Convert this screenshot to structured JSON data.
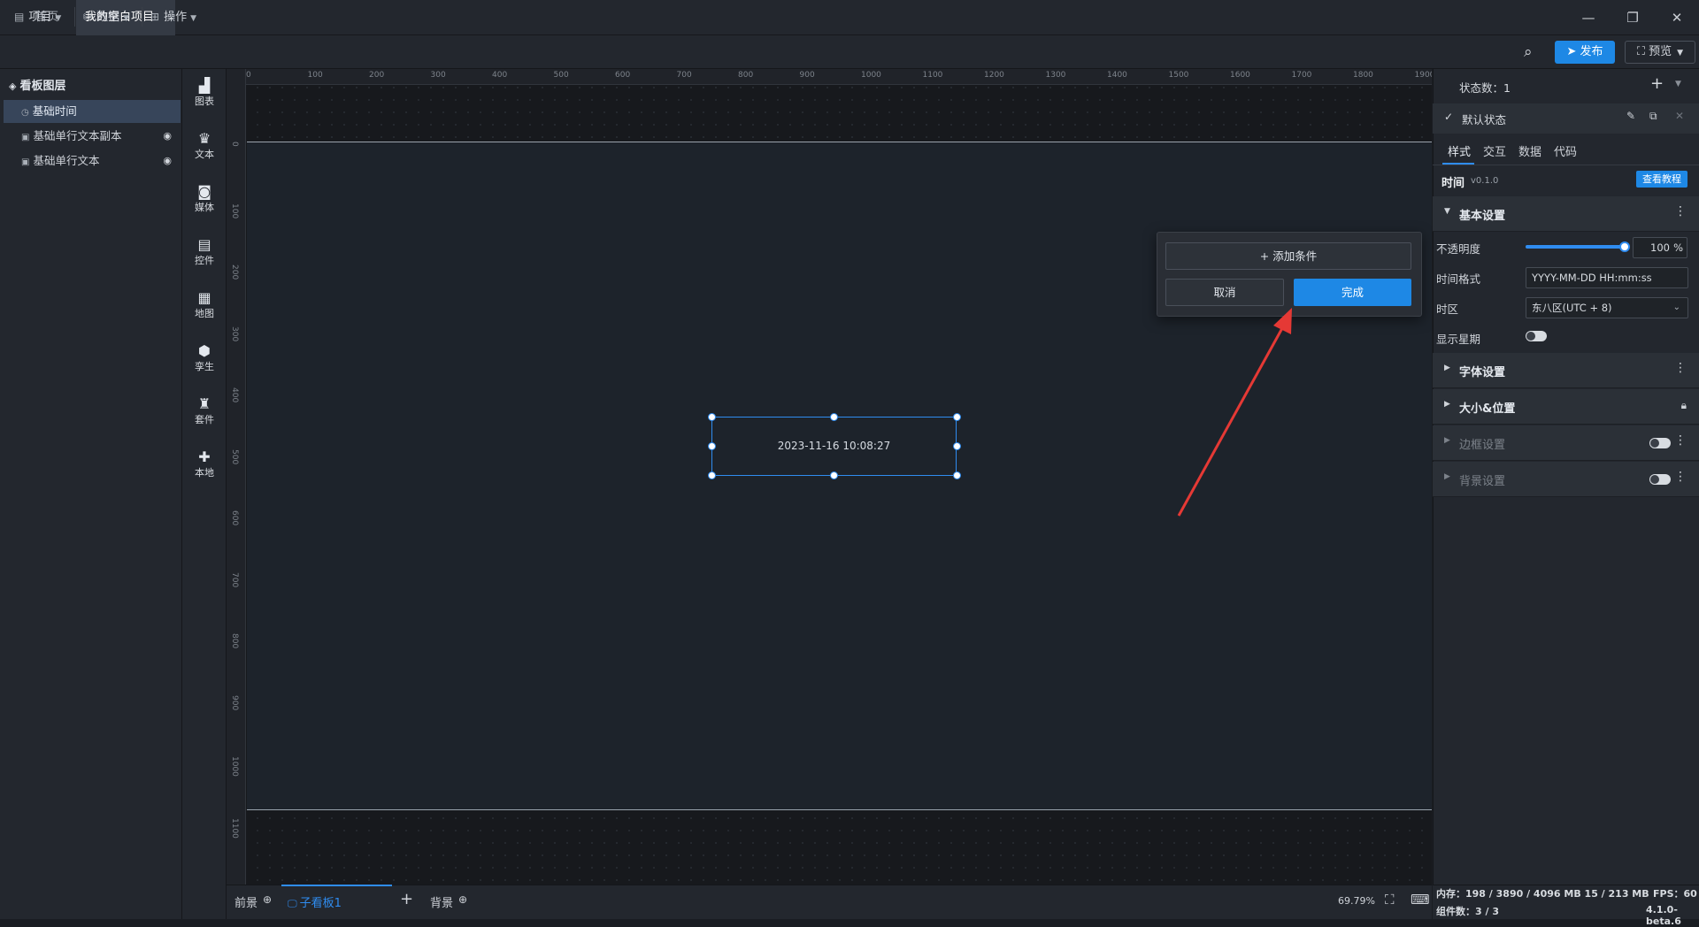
{
  "titlebar": {
    "tabs": [
      {
        "label": "首页"
      },
      {
        "label": "我的空白项目"
      }
    ]
  },
  "menubar": {
    "project": "项目",
    "data": "数据",
    "operate": "操作",
    "publish": "发布",
    "preview": "预览"
  },
  "layers": {
    "title": "看板图层",
    "items": [
      {
        "label": "基础时间"
      },
      {
        "label": "基础单行文本副本"
      },
      {
        "label": "基础单行文本"
      }
    ]
  },
  "components": [
    {
      "label": "图表",
      "icon": "bar-chart-icon"
    },
    {
      "label": "文本",
      "icon": "text-icon"
    },
    {
      "label": "媒体",
      "icon": "media-icon"
    },
    {
      "label": "控件",
      "icon": "control-icon"
    },
    {
      "label": "地图",
      "icon": "map-icon"
    },
    {
      "label": "孪生",
      "icon": "twin-cube-icon"
    },
    {
      "label": "套件",
      "icon": "kit-shirt-icon"
    },
    {
      "label": "本地",
      "icon": "puzzle-icon"
    }
  ],
  "ruler": {
    "top": [
      "0",
      "100",
      "200",
      "300",
      "400",
      "500",
      "600",
      "700",
      "800",
      "900",
      "1000",
      "1100",
      "1200",
      "1300",
      "1400",
      "1500",
      "1600",
      "1700",
      "1800",
      "1900"
    ],
    "left": [
      "0",
      "100",
      "200",
      "300",
      "400",
      "500",
      "600",
      "700",
      "800",
      "900",
      "1000",
      "1100"
    ]
  },
  "canvas": {
    "widget_text": "2023-11-16 10:08:27"
  },
  "popover": {
    "add_condition": "添加条件",
    "cancel": "取消",
    "done": "完成"
  },
  "bottombar": {
    "foreground": "前景",
    "board": "子看板1",
    "background": "背景",
    "zoom": "69.79%"
  },
  "rpanel": {
    "state_count": "状态数：1",
    "default_state": "默认状态",
    "tabs": [
      "样式",
      "交互",
      "数据",
      "代码"
    ],
    "component_name": "时间",
    "version": "v0.1.0",
    "tutorial": "查看教程",
    "basic_settings": "基本设置",
    "opacity_label": "不透明度",
    "opacity_value": "100",
    "opacity_unit": "%",
    "opacity_fraction": 1.0,
    "time_format_label": "时间格式",
    "time_format_value": "YYYY-MM-DD HH:mm:ss",
    "timezone_label": "时区",
    "timezone_value": "东八区(UTC + 8)",
    "show_weekday_label": "显示星期",
    "font_settings": "字体设置",
    "size_position": "大小&位置",
    "border_settings": "边框设置",
    "background_settings": "背景设置"
  },
  "status": {
    "memory": "内存：198 / 3890 / 4096 MB  15 / 213 MB",
    "fps": "FPS：60",
    "count": "组件数：3 / 3",
    "version": "4.1.0-beta.6"
  },
  "colors": {
    "accent": "#1e88e5",
    "annotation_arrow": "#e53935"
  }
}
